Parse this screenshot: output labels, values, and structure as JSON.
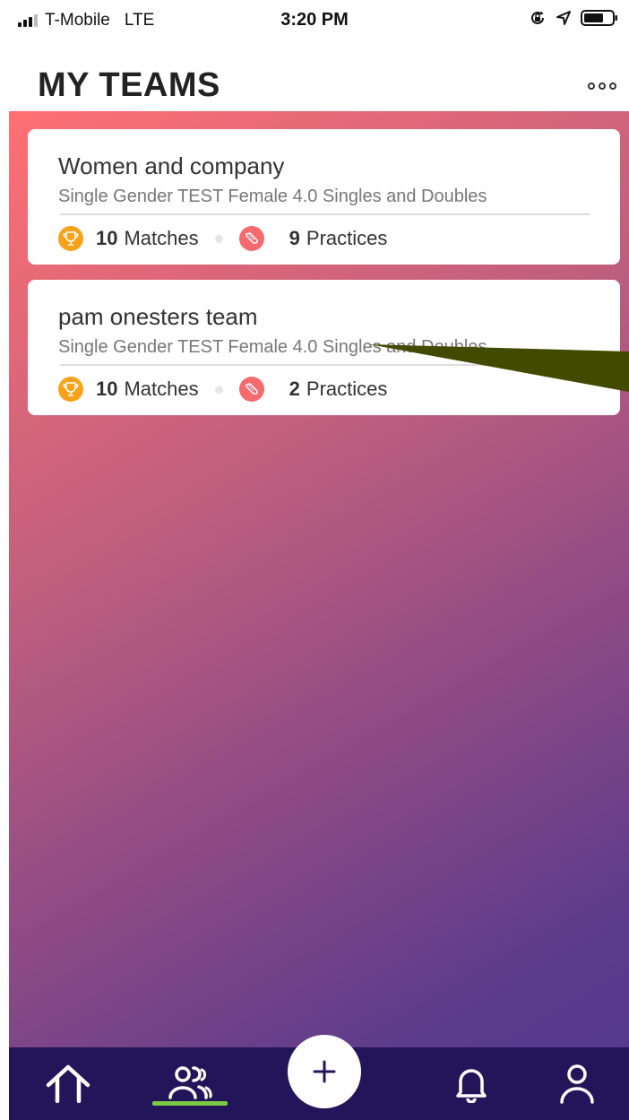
{
  "status_bar": {
    "carrier": "T-Mobile",
    "network": "LTE",
    "time": "3:20 PM",
    "icons": [
      "orientation-lock-icon",
      "location-icon",
      "battery-icon"
    ]
  },
  "header": {
    "title": "MY TEAMS",
    "menu_icon": "more-dots-icon"
  },
  "teams": [
    {
      "name": "Women and company",
      "description": "Single Gender TEST Female 4.0 Singles and Doubles",
      "matches_count": "10",
      "matches_label": "Matches",
      "practices_count": "9",
      "practices_label": "Practices"
    },
    {
      "name": "pam onesters team",
      "description": "Single Gender TEST Female 4.0 Singles and Doubles",
      "matches_count": "10",
      "matches_label": "Matches",
      "practices_count": "2",
      "practices_label": "Practices"
    }
  ],
  "bottom_nav": {
    "items": [
      "home-icon",
      "teams-icon",
      "add-icon",
      "bell-icon",
      "profile-icon"
    ],
    "active": "teams-icon"
  },
  "colors": {
    "gradient_start": "#ff7073",
    "gradient_end": "#553a8c",
    "nav_background": "#231559",
    "active_indicator": "#7ac943",
    "trophy_badge": "#f8a21a",
    "shoe_badge": "#f76a6e",
    "annotation_arrow": "#424a00"
  }
}
